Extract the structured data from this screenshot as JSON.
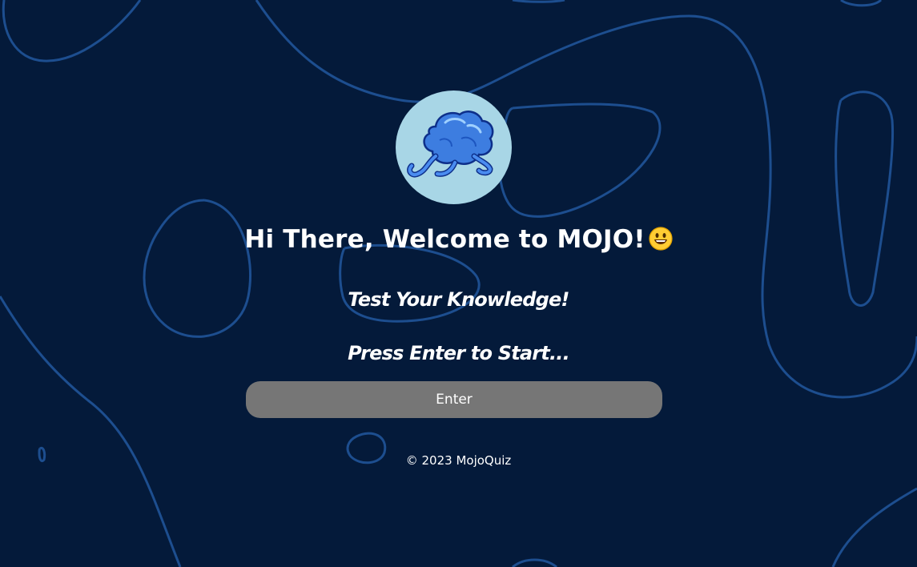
{
  "app": {
    "logo_icon": "brain-runner-icon",
    "logo_bg_color": "#a8d6e6",
    "background_color": "#041a3a",
    "outline_color": "#1d4e8f"
  },
  "main": {
    "heading": "Hi There, Welcome to MOJO!",
    "heading_emoji_icon": "smiling-face-icon",
    "subtitle": "Test Your Knowledge!",
    "prompt": "Press Enter to Start...",
    "enter_button_label": "Enter",
    "button_color": "#767676"
  },
  "footer": {
    "text": "© 2023 MojoQuiz"
  }
}
